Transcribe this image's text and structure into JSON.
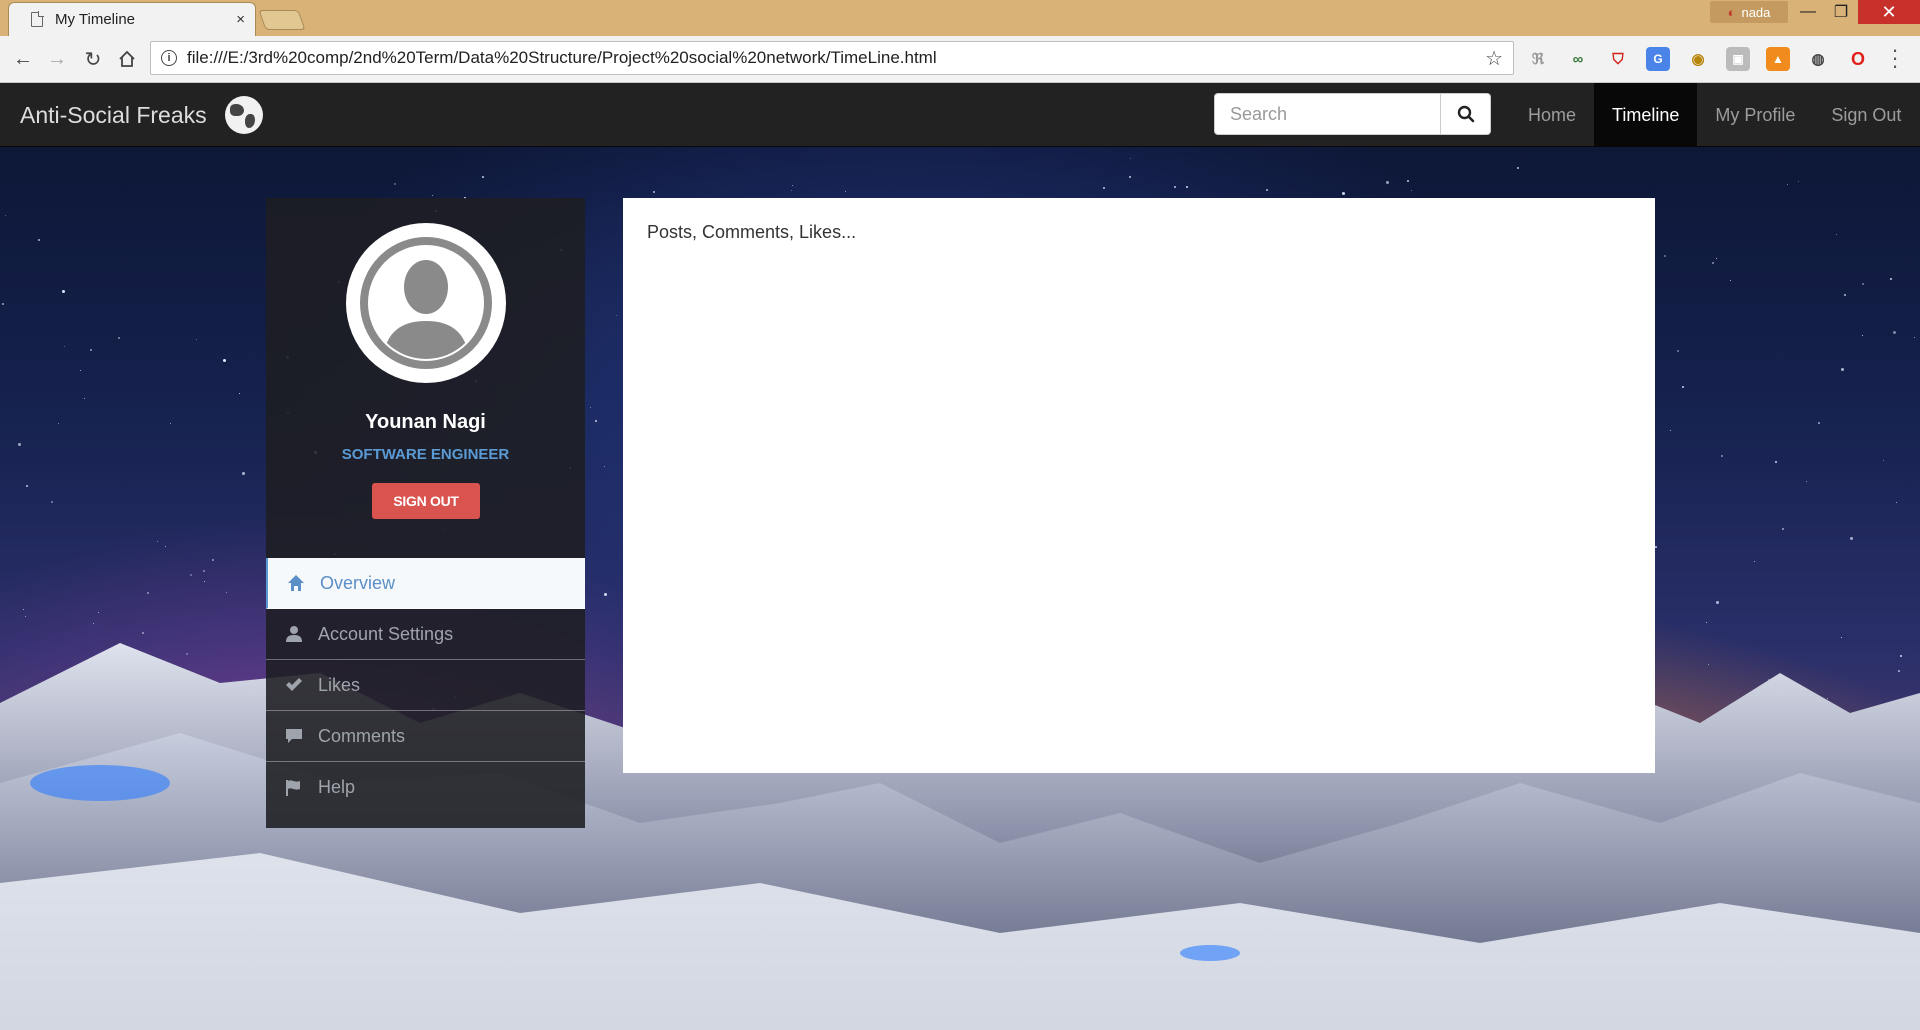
{
  "browser": {
    "tab_title": "My Timeline",
    "tab_close": "×",
    "profile_name": "nada",
    "url": "file:///E:/3rd%20comp/2nd%20Term/Data%20Structure/Project%20social%20network/TimeLine.html",
    "window_controls": {
      "minimize": "—",
      "maximize": "❐",
      "close": "✕"
    },
    "extensions": [
      "translate-ext-icon",
      "glasses-ext-icon",
      "shield-ext-icon",
      "google-translate-ext-icon",
      "eye-ext-icon",
      "gray-ext-icon",
      "orange-ext-icon",
      "globe-ext-icon",
      "opera-ext-icon"
    ]
  },
  "navbar": {
    "brand": "Anti-Social Freaks",
    "search_placeholder": "Search",
    "links": [
      {
        "label": "Home",
        "active": false
      },
      {
        "label": "Timeline",
        "active": true
      },
      {
        "label": "My Profile",
        "active": false
      },
      {
        "label": "Sign Out",
        "active": false
      }
    ]
  },
  "profile": {
    "name": "Younan Nagi",
    "title": "SOFTWARE ENGINEER",
    "signout_label": "SIGN OUT"
  },
  "sidebar": {
    "items": [
      {
        "label": "Overview",
        "icon": "home-icon",
        "active": true
      },
      {
        "label": "Account Settings",
        "icon": "user-icon",
        "active": false
      },
      {
        "label": "Likes",
        "icon": "check-icon",
        "active": false
      },
      {
        "label": "Comments",
        "icon": "comment-icon",
        "active": false
      },
      {
        "label": "Help",
        "icon": "flag-icon",
        "active": false
      }
    ]
  },
  "main": {
    "content_text": "Posts, Comments, Likes..."
  },
  "colors": {
    "navbar_bg": "#222222",
    "accent_blue": "#5b9bd5",
    "danger_red": "#d9534f",
    "tabstrip": "#d8b277"
  }
}
